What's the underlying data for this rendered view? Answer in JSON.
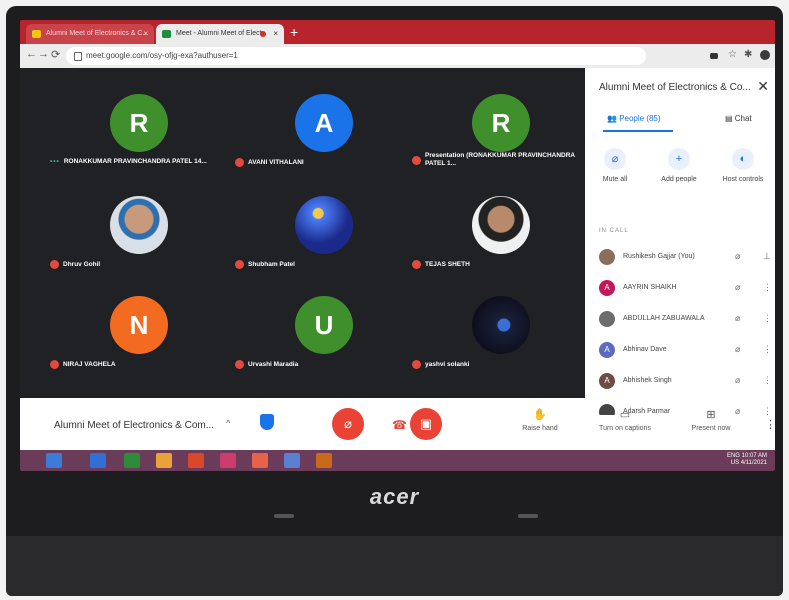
{
  "browser": {
    "tabs": [
      {
        "label": "Alumni Meet of Electronics & C...",
        "active": false
      },
      {
        "label": "Meet - Alumni Meet of Elect",
        "active": true
      }
    ],
    "url": "meet.google.com/osy-ofjg-exa?authuser=1"
  },
  "tiles": [
    {
      "name": "RONAKKUMAR PRAVINCHANDRA PATEL 14...",
      "initial": "R",
      "color": "#3f8f2c",
      "status": "speaking"
    },
    {
      "name": "AVANI VITHALANI",
      "initial": "A",
      "color": "#1a73e8",
      "status": "muted"
    },
    {
      "name": "Presentation (RONAKKUMAR PRAVINCHANDRA PATEL 1...",
      "initial": "R",
      "color": "#3f8f2c",
      "status": "muted"
    },
    {
      "name": "Dhruv Gohil",
      "initial": "",
      "color": "",
      "status": "muted"
    },
    {
      "name": "Shubham Patel",
      "initial": "",
      "color": "",
      "status": "muted"
    },
    {
      "name": "TEJAS SHETH",
      "initial": "",
      "color": "",
      "status": "muted"
    },
    {
      "name": "NIRAJ VAGHELA",
      "initial": "N",
      "color": "#f36a21",
      "status": "muted"
    },
    {
      "name": "Urvashi Maradia",
      "initial": "U",
      "color": "#3f8f2c",
      "status": "muted"
    },
    {
      "name": "yashvi solanki",
      "initial": "",
      "color": "",
      "status": "muted"
    }
  ],
  "panel": {
    "title": "Alumni Meet of Electronics & Co...",
    "people_tab": "People (85)",
    "chat_tab": "Chat",
    "actions": [
      "Mute all",
      "Add people",
      "Host controls"
    ],
    "section": "IN CALL",
    "people": [
      {
        "name": "Rushikesh Gajjar (You)",
        "initial": "",
        "color": "#8a6d5a"
      },
      {
        "name": "AAYRIN SHAIKH",
        "initial": "A",
        "color": "#c2185b"
      },
      {
        "name": "ABDULLAH ZABUAWALA",
        "initial": "",
        "color": "#6d6d6d"
      },
      {
        "name": "Abhinav Dave",
        "initial": "A",
        "color": "#5c6bc0"
      },
      {
        "name": "Abhishek Singh",
        "initial": "A",
        "color": "#6d4c41"
      },
      {
        "name": "Adarsh Parmar",
        "initial": "",
        "color": "#444"
      }
    ]
  },
  "bottom": {
    "meeting_name": "Alumni Meet of Electronics & Com...",
    "raise_hand": "Raise hand",
    "captions": "Turn on captions",
    "present": "Present now"
  },
  "taskbar": {
    "lang": "ENG",
    "region": "US",
    "time": "10:07 AM",
    "date": "4/11/2021"
  },
  "laptop_brand": "acer"
}
